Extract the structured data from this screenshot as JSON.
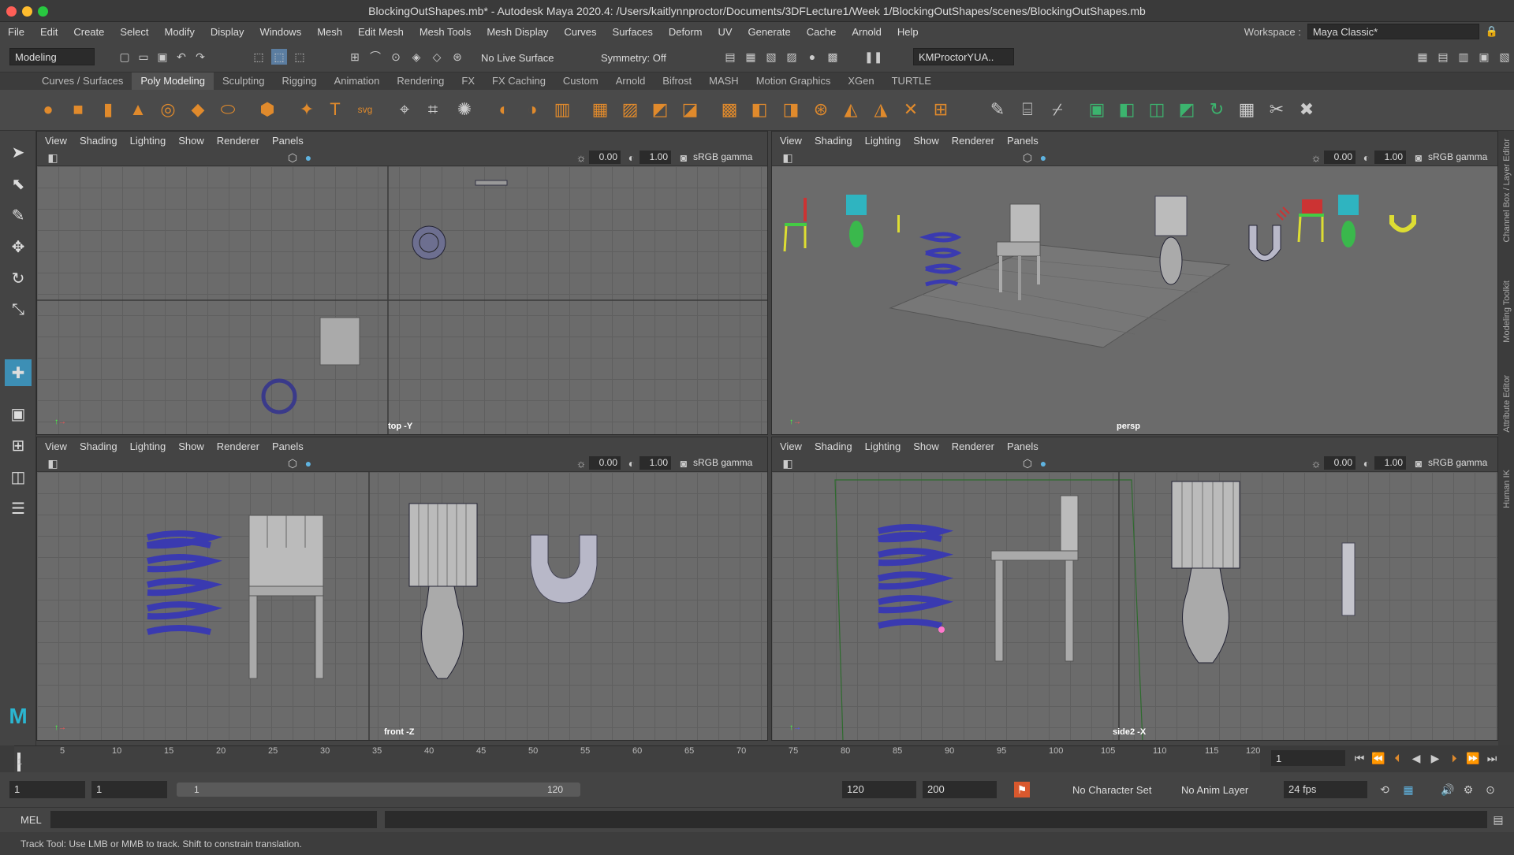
{
  "window": {
    "title": "BlockingOutShapes.mb* - Autodesk Maya 2020.4: /Users/kaitlynnproctor/Documents/3DFLecture1/Week 1/BlockingOutShapes/scenes/BlockingOutShapes.mb"
  },
  "menu": [
    "File",
    "Edit",
    "Create",
    "Select",
    "Modify",
    "Display",
    "Windows",
    "Mesh",
    "Edit Mesh",
    "Mesh Tools",
    "Mesh Display",
    "Curves",
    "Surfaces",
    "Deform",
    "UV",
    "Generate",
    "Cache",
    "Arnold",
    "Help"
  ],
  "workspace": {
    "label": "Workspace :",
    "value": "Maya Classic*"
  },
  "status": {
    "mode": "Modeling",
    "live": "No Live Surface",
    "symmetry": "Symmetry: Off",
    "user": "KMProctorYUA.."
  },
  "shelf_tabs": [
    "Curves / Surfaces",
    "Poly Modeling",
    "Sculpting",
    "Rigging",
    "Animation",
    "Rendering",
    "FX",
    "FX Caching",
    "Custom",
    "Arnold",
    "Bifrost",
    "MASH",
    "Motion Graphics",
    "XGen",
    "TURTLE"
  ],
  "viewport_menu": [
    "View",
    "Shading",
    "Lighting",
    "Show",
    "Renderer",
    "Panels"
  ],
  "viewport": {
    "exposure": "0.00",
    "gamma_val": "1.00",
    "gamma": "sRGB gamma"
  },
  "panels": {
    "top": "top -Y",
    "persp": "persp",
    "front": "front -Z",
    "side": "side2 -X"
  },
  "right_tabs": [
    "Channel Box / Layer Editor",
    "Modeling Toolkit",
    "Attribute Editor",
    "Human IK"
  ],
  "timeline": {
    "ticks": [
      "5",
      "10",
      "15",
      "20",
      "25",
      "30",
      "35",
      "40",
      "45",
      "50",
      "55",
      "60",
      "65",
      "70",
      "75",
      "80",
      "85",
      "90",
      "95",
      "100",
      "105",
      "110",
      "115",
      "120"
    ],
    "current": "1",
    "frame_field": "1"
  },
  "range": {
    "start": "1",
    "start2": "1",
    "slider_start": "1",
    "slider_end": "120",
    "end": "120",
    "end2": "200",
    "char_set": "No Character Set",
    "anim_layer": "No Anim Layer",
    "fps": "24 fps"
  },
  "command": {
    "lang": "MEL"
  },
  "help": "Track Tool: Use LMB or MMB to track. Shift to constrain translation."
}
